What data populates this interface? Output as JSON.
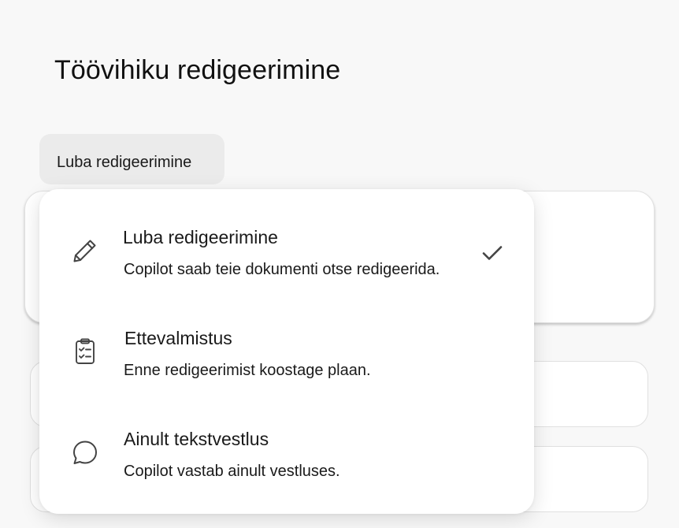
{
  "page": {
    "title": "Töövihiku redigeerimine"
  },
  "mode_button": {
    "label": "Luba redigeerimine"
  },
  "menu": {
    "selected_index": 0,
    "options": [
      {
        "title": "Luba redigeerimine",
        "description": "Copilot saab teie dokumenti otse redigeerida.",
        "icon": "pencil-icon",
        "selected": true
      },
      {
        "title": "Ettevalmistus",
        "description": "Enne redigeerimist koostage plaan.",
        "icon": "clipboard-checklist-icon",
        "selected": false
      },
      {
        "title": "Ainult tekstvestlus",
        "description": "Copilot vastab ainult vestluses.",
        "icon": "chat-bubble-icon",
        "selected": false
      }
    ]
  },
  "colors": {
    "background": "#f8f8f8",
    "button_bg": "#ebebeb",
    "menu_bg": "#ffffff",
    "text": "#1a1a1a",
    "icon": "#444444"
  }
}
